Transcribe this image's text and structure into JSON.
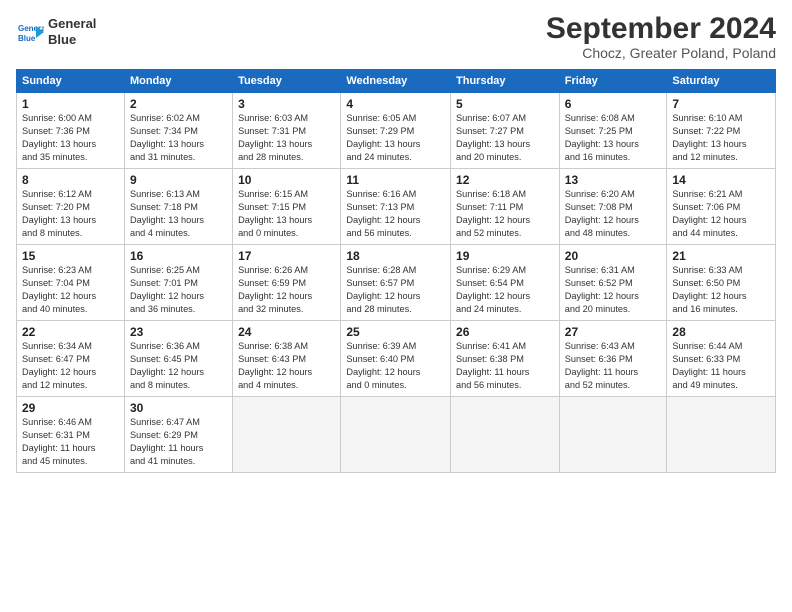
{
  "header": {
    "logo_line1": "General",
    "logo_line2": "Blue",
    "title": "September 2024",
    "subtitle": "Chocz, Greater Poland, Poland"
  },
  "days_of_week": [
    "Sunday",
    "Monday",
    "Tuesday",
    "Wednesday",
    "Thursday",
    "Friday",
    "Saturday"
  ],
  "weeks": [
    [
      {
        "day": "1",
        "info": "Sunrise: 6:00 AM\nSunset: 7:36 PM\nDaylight: 13 hours\nand 35 minutes."
      },
      {
        "day": "2",
        "info": "Sunrise: 6:02 AM\nSunset: 7:34 PM\nDaylight: 13 hours\nand 31 minutes."
      },
      {
        "day": "3",
        "info": "Sunrise: 6:03 AM\nSunset: 7:31 PM\nDaylight: 13 hours\nand 28 minutes."
      },
      {
        "day": "4",
        "info": "Sunrise: 6:05 AM\nSunset: 7:29 PM\nDaylight: 13 hours\nand 24 minutes."
      },
      {
        "day": "5",
        "info": "Sunrise: 6:07 AM\nSunset: 7:27 PM\nDaylight: 13 hours\nand 20 minutes."
      },
      {
        "day": "6",
        "info": "Sunrise: 6:08 AM\nSunset: 7:25 PM\nDaylight: 13 hours\nand 16 minutes."
      },
      {
        "day": "7",
        "info": "Sunrise: 6:10 AM\nSunset: 7:22 PM\nDaylight: 13 hours\nand 12 minutes."
      }
    ],
    [
      {
        "day": "8",
        "info": "Sunrise: 6:12 AM\nSunset: 7:20 PM\nDaylight: 13 hours\nand 8 minutes."
      },
      {
        "day": "9",
        "info": "Sunrise: 6:13 AM\nSunset: 7:18 PM\nDaylight: 13 hours\nand 4 minutes."
      },
      {
        "day": "10",
        "info": "Sunrise: 6:15 AM\nSunset: 7:15 PM\nDaylight: 13 hours\nand 0 minutes."
      },
      {
        "day": "11",
        "info": "Sunrise: 6:16 AM\nSunset: 7:13 PM\nDaylight: 12 hours\nand 56 minutes."
      },
      {
        "day": "12",
        "info": "Sunrise: 6:18 AM\nSunset: 7:11 PM\nDaylight: 12 hours\nand 52 minutes."
      },
      {
        "day": "13",
        "info": "Sunrise: 6:20 AM\nSunset: 7:08 PM\nDaylight: 12 hours\nand 48 minutes."
      },
      {
        "day": "14",
        "info": "Sunrise: 6:21 AM\nSunset: 7:06 PM\nDaylight: 12 hours\nand 44 minutes."
      }
    ],
    [
      {
        "day": "15",
        "info": "Sunrise: 6:23 AM\nSunset: 7:04 PM\nDaylight: 12 hours\nand 40 minutes."
      },
      {
        "day": "16",
        "info": "Sunrise: 6:25 AM\nSunset: 7:01 PM\nDaylight: 12 hours\nand 36 minutes."
      },
      {
        "day": "17",
        "info": "Sunrise: 6:26 AM\nSunset: 6:59 PM\nDaylight: 12 hours\nand 32 minutes."
      },
      {
        "day": "18",
        "info": "Sunrise: 6:28 AM\nSunset: 6:57 PM\nDaylight: 12 hours\nand 28 minutes."
      },
      {
        "day": "19",
        "info": "Sunrise: 6:29 AM\nSunset: 6:54 PM\nDaylight: 12 hours\nand 24 minutes."
      },
      {
        "day": "20",
        "info": "Sunrise: 6:31 AM\nSunset: 6:52 PM\nDaylight: 12 hours\nand 20 minutes."
      },
      {
        "day": "21",
        "info": "Sunrise: 6:33 AM\nSunset: 6:50 PM\nDaylight: 12 hours\nand 16 minutes."
      }
    ],
    [
      {
        "day": "22",
        "info": "Sunrise: 6:34 AM\nSunset: 6:47 PM\nDaylight: 12 hours\nand 12 minutes."
      },
      {
        "day": "23",
        "info": "Sunrise: 6:36 AM\nSunset: 6:45 PM\nDaylight: 12 hours\nand 8 minutes."
      },
      {
        "day": "24",
        "info": "Sunrise: 6:38 AM\nSunset: 6:43 PM\nDaylight: 12 hours\nand 4 minutes."
      },
      {
        "day": "25",
        "info": "Sunrise: 6:39 AM\nSunset: 6:40 PM\nDaylight: 12 hours\nand 0 minutes."
      },
      {
        "day": "26",
        "info": "Sunrise: 6:41 AM\nSunset: 6:38 PM\nDaylight: 11 hours\nand 56 minutes."
      },
      {
        "day": "27",
        "info": "Sunrise: 6:43 AM\nSunset: 6:36 PM\nDaylight: 11 hours\nand 52 minutes."
      },
      {
        "day": "28",
        "info": "Sunrise: 6:44 AM\nSunset: 6:33 PM\nDaylight: 11 hours\nand 49 minutes."
      }
    ],
    [
      {
        "day": "29",
        "info": "Sunrise: 6:46 AM\nSunset: 6:31 PM\nDaylight: 11 hours\nand 45 minutes."
      },
      {
        "day": "30",
        "info": "Sunrise: 6:47 AM\nSunset: 6:29 PM\nDaylight: 11 hours\nand 41 minutes."
      },
      {
        "day": "",
        "info": ""
      },
      {
        "day": "",
        "info": ""
      },
      {
        "day": "",
        "info": ""
      },
      {
        "day": "",
        "info": ""
      },
      {
        "day": "",
        "info": ""
      }
    ]
  ]
}
